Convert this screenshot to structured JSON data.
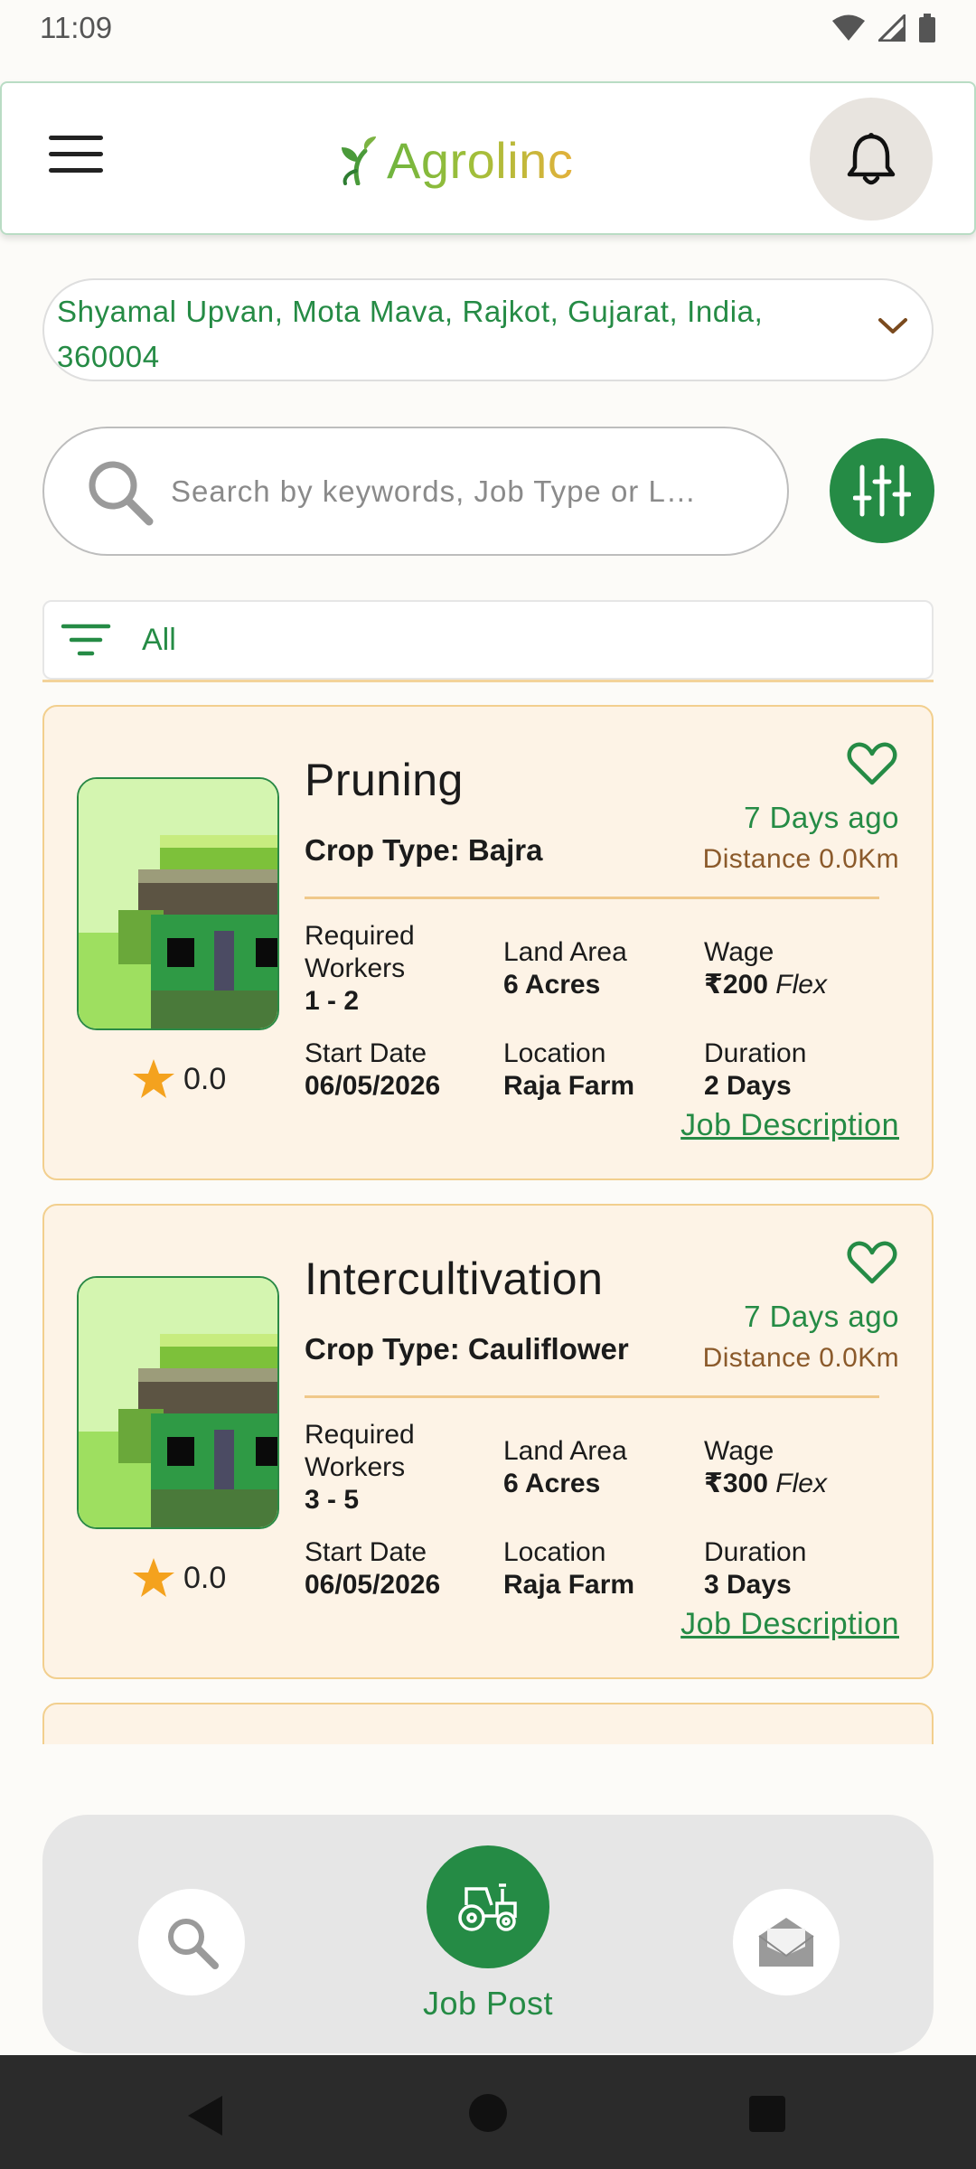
{
  "status_bar": {
    "time": "11:09"
  },
  "header": {
    "app_name": "Agrolinc"
  },
  "location": {
    "address": "Shyamal Upvan, Mota Mava, Rajkot, Gujarat, India, 360004"
  },
  "search": {
    "placeholder": "Search by keywords,  Job Type or L…"
  },
  "category_filter": {
    "selected": "All"
  },
  "jobs": [
    {
      "title": "Pruning",
      "crop_type": "Crop Type: Bajra",
      "posted_ago": "7 Days ago",
      "distance": "Distance 0.0Km",
      "rating": "0.0",
      "workers_label": "Required Workers",
      "workers": "1 - 2",
      "land_label": "Land Area",
      "land": "6 Acres",
      "wage_label": "Wage",
      "wage": "₹200",
      "wage_type": "Flex",
      "start_label": "Start Date",
      "start": "06/05/2026",
      "location_label": "Location",
      "location": "Raja Farm",
      "duration_label": "Duration",
      "duration": "2 Days",
      "description_link": "Job Description"
    },
    {
      "title": "Intercultivation",
      "crop_type": "Crop Type: Cauliflower",
      "posted_ago": "7 Days ago",
      "distance": "Distance 0.0Km",
      "rating": "0.0",
      "workers_label": "Required Workers",
      "workers": "3 - 5",
      "land_label": "Land Area",
      "land": "6 Acres",
      "wage_label": "Wage",
      "wage": "₹300",
      "wage_type": "Flex",
      "start_label": "Start Date",
      "start": "06/05/2026",
      "location_label": "Location",
      "location": "Raja Farm",
      "duration_label": "Duration",
      "duration": "3 Days",
      "description_link": "Job Description"
    }
  ],
  "bottom_nav": {
    "items": [
      {
        "icon": "search-icon"
      },
      {
        "icon": "tractor-icon",
        "label": "Job Post"
      },
      {
        "icon": "envelope-open-icon"
      }
    ]
  },
  "colors": {
    "brand_green": "#258b45",
    "card_bg": "#fdf3e6",
    "card_border": "#f2cf8e",
    "distance_brown": "#8b5a2b"
  }
}
